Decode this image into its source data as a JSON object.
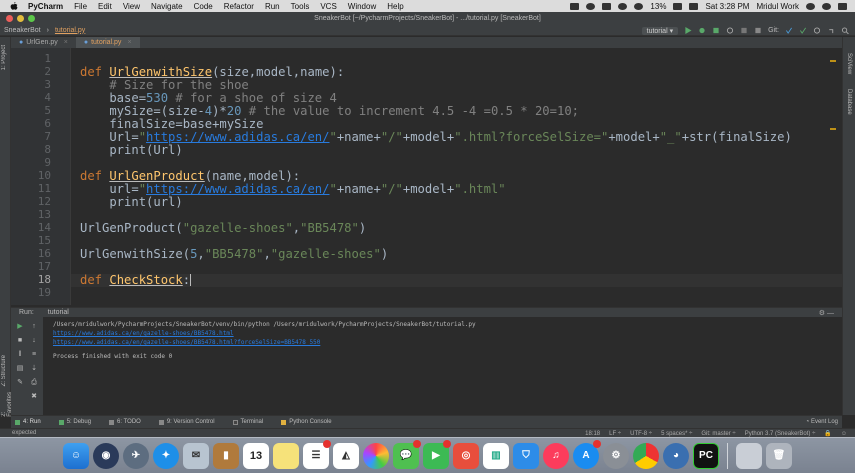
{
  "menubar": {
    "app": "PyCharm",
    "items": [
      "File",
      "Edit",
      "View",
      "Navigate",
      "Code",
      "Refactor",
      "Run",
      "Tools",
      "VCS",
      "Window",
      "Help"
    ],
    "battery": "13%",
    "clock": "Sat 3:28 PM",
    "user": "Mridul Work"
  },
  "window": {
    "title": "SneakerBot [~/PycharmProjects/SneakerBot] - .../tutorial.py [SneakerBot]"
  },
  "navbar": {
    "project": "SneakerBot",
    "file": "tutorial.py",
    "run_config": "tutorial",
    "git_label": "Git:"
  },
  "tabs": [
    {
      "label": "UrlGen.py",
      "active": false
    },
    {
      "label": "tutorial.py",
      "active": true
    }
  ],
  "left_stripe": {
    "project": "1: Project",
    "structure": "Z: Structure",
    "favorites": "2: Favorites"
  },
  "right_stripe": {
    "scview": "SciView",
    "database": "Database"
  },
  "editor": {
    "line_numbers": [
      "1",
      "2",
      "3",
      "4",
      "5",
      "6",
      "7",
      "8",
      "9",
      "10",
      "11",
      "12",
      "13",
      "14",
      "15",
      "16",
      "17",
      "18",
      "19"
    ],
    "current_line": "18",
    "lines": {
      "l2_def": "def ",
      "l2_name": "UrlGenwithSize",
      "l2_params": "(size,model,name):",
      "l3": "    # Size for the shoe",
      "l4_a": "    base=",
      "l4_num": "530",
      "l4_cm": " # for a shoe of size 4",
      "l5_a": "    mySize=(size-",
      "l5_n1": "4",
      "l5_b": ")*",
      "l5_n2": "20",
      "l5_cm": " # the value to increment 4.5 -4 =0.5 * 20=10;",
      "l6": "    finalSize=base+mySize",
      "l7_a": "    Url=",
      "l7_q1": "\"",
      "l7_url": "https://www.adidas.ca/en/",
      "l7_q2": "\"",
      "l7_b": "+name+",
      "l7_s1": "\"/\"",
      "l7_c": "+model+",
      "l7_s2": "\".html?forceSelSize=\"",
      "l7_d": "+model+",
      "l7_s3": "\"_\"",
      "l7_e": "+str(finalSize)",
      "l8": "    print(Url)",
      "l10_def": "def ",
      "l10_name": "UrlGenProduct",
      "l10_params": "(name,model):",
      "l11_a": "    url=",
      "l11_q1": "\"",
      "l11_url": "https://www.adidas.ca/en/",
      "l11_q2": "\"",
      "l11_b": "+name+",
      "l11_s1": "\"/\"",
      "l11_c": "+model+",
      "l11_s2": "\".html\"",
      "l12": "    print(url)",
      "l14_a": "UrlGenProduct(",
      "l14_s1": "\"gazelle-shoes\"",
      "l14_b": ",",
      "l14_s2": "\"BB5478\"",
      "l14_c": ")",
      "l16_a": "UrlGenwithSize(",
      "l16_n": "5",
      "l16_b": ",",
      "l16_s1": "\"BB5478\"",
      "l16_c": ",",
      "l16_s2": "\"gazelle-shoes\"",
      "l16_d": ")",
      "l18_def": "def ",
      "l18_name": "CheckStock",
      "l18_colon": ":"
    }
  },
  "run": {
    "label": "Run:",
    "config": "tutorial",
    "command": "/Users/mridulwork/PycharmProjects/SneakerBot/venv/bin/python /Users/mridulwork/PycharmProjects/SneakerBot/tutorial.py",
    "out1": "https://www.adidas.ca/en/gazelle-shoes/BB5478.html",
    "out2": "https://www.adidas.ca/en/gazelle-shoes/BB5478.html?forceSelSize=BB5478_550",
    "exit": "Process finished with exit code 0"
  },
  "bottom_tabs": [
    "4: Run",
    "5: Debug",
    "6: TODO",
    "9: Version Control",
    "Terminal",
    "Python Console"
  ],
  "event_log": "Event Log",
  "status": {
    "left": "expected",
    "position": "18:18",
    "line_sep": "LF ÷",
    "encoding": "UTF-8 ÷",
    "indent": "5 spaces* ÷",
    "git": "Git: master ÷",
    "interpreter": "Python 3.7 (SneakerBot) ÷"
  },
  "dock": {
    "calendar_day": "13",
    "pycharm": "PC"
  },
  "colors": {
    "editor_bg": "#2b2b2b",
    "keyword": "#cc7832",
    "function": "#ffc66d",
    "string": "#6a8759",
    "number": "#6897bb",
    "comment": "#808080",
    "link": "#287bde"
  }
}
